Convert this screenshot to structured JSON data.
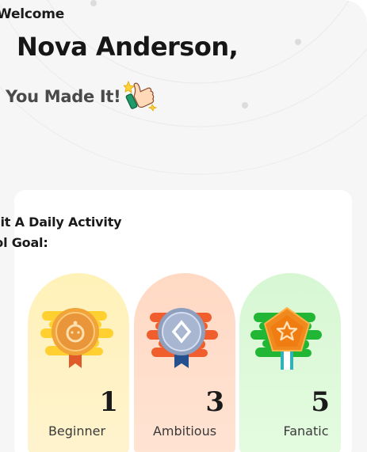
{
  "header": {
    "welcome": "Welcome",
    "user_name": "Nova Anderson,",
    "subtitle": "You Made It!",
    "celebration_icon": "thumbs-up-icon"
  },
  "goal_section": {
    "line1": "mit A Daily Activity",
    "line2": "col Goal:"
  },
  "badges": [
    {
      "level": "1",
      "label": "Beginner",
      "icon": "bronze-medal-icon"
    },
    {
      "level": "3",
      "label": "Ambitious",
      "icon": "silver-medal-icon"
    },
    {
      "level": "5",
      "label": "Fanatic",
      "icon": "gold-star-medal-icon"
    }
  ],
  "colors": {
    "background": "#f6f6f6",
    "beginner_card": "#fff2c4",
    "ambitious_card": "#ffdfcd",
    "fanatic_card": "#ddf8d8"
  }
}
